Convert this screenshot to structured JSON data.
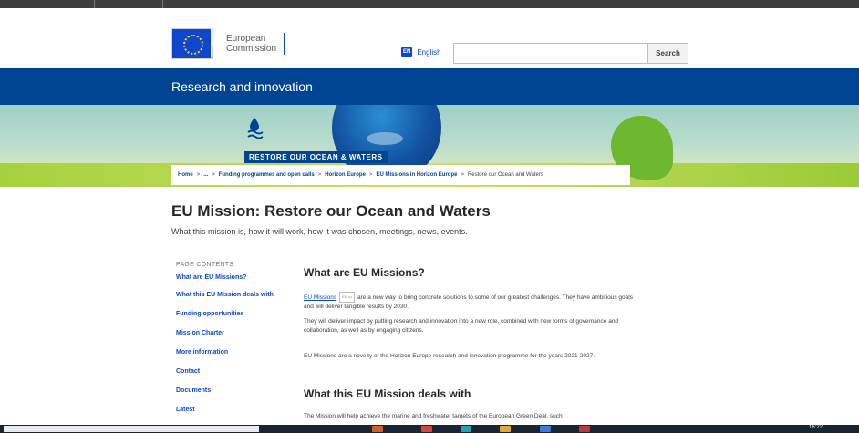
{
  "header": {
    "logo_line1": "European",
    "logo_line2": "Commission",
    "language_code": "EN",
    "language_label": "English",
    "search_button": "Search",
    "search_placeholder": ""
  },
  "band": {
    "title": "Research and innovation"
  },
  "hero": {
    "badge": "RESTORE OUR OCEAN & WATERS"
  },
  "breadcrumb": [
    "Home",
    "...",
    "Funding programmes and open calls",
    "Horizon Europe",
    "EU Missions in Horizon Europe",
    "Restore our Ocean and Waters"
  ],
  "page": {
    "title": "EU Mission: Restore our Ocean and Waters",
    "subtitle": "What this mission is, how it will work, how it was chosen, meetings, news, events."
  },
  "toc": {
    "label": "PAGE CONTENTS",
    "items": [
      "What are EU Missions?",
      "What this EU Mission deals with",
      "Funding opportunities",
      "Mission Charter",
      "More information",
      "Contact",
      "Documents",
      "Latest"
    ]
  },
  "content": {
    "section1_title": "What are EU Missions?",
    "p1_link": "EU Missions",
    "p1_ext": "EN •••",
    "p1_text": "are a new way to bring concrete solutions to some of our greatest challenges. They have ambitious goals and will deliver tangible results by 2030.",
    "p2": "They will deliver impact by putting research and innovation into a new role, combined with new forms of governance and collaboration, as well as by engaging citizens.",
    "p3": "EU Missions are a novelty of the Horizon Europe research and innovation programme for the years 2021-2027.",
    "section2_title": "What this EU Mission deals with",
    "p4": "The Mission will help achieve the marine and freshwater targets of the European Green Deal, such"
  },
  "taskbar": {
    "clock": "16:22"
  },
  "colors": {
    "brand_blue": "#004494",
    "link_blue": "#0e47cb"
  }
}
